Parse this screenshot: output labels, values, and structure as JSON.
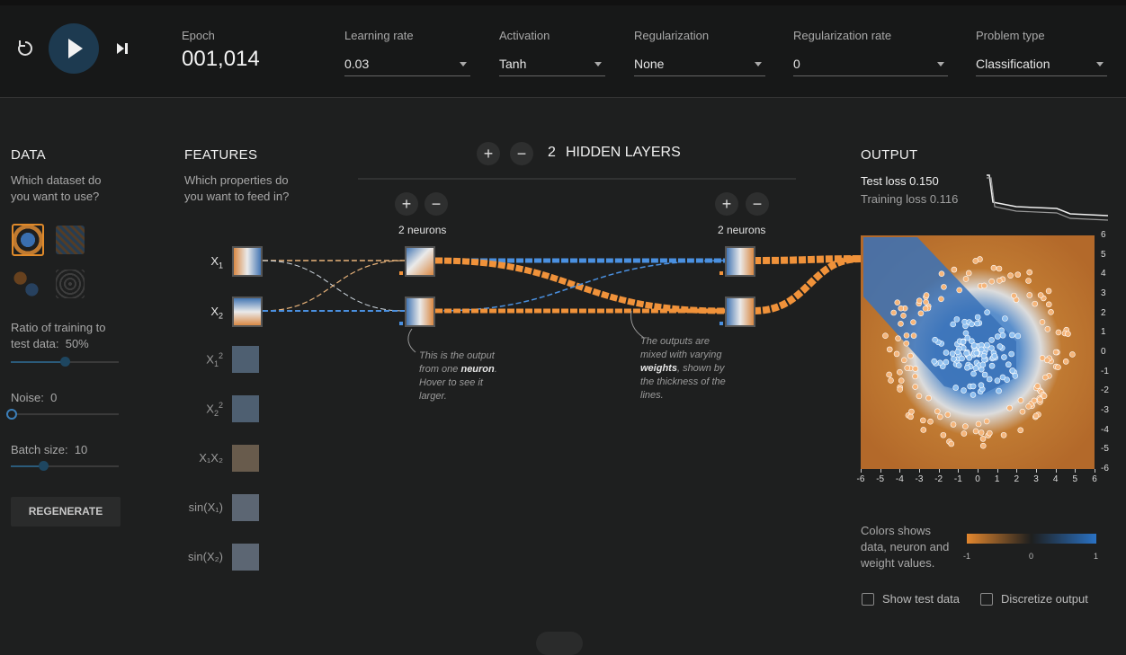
{
  "topbar": {
    "epoch_label": "Epoch",
    "epoch_value": "001,014",
    "learning_rate": {
      "label": "Learning rate",
      "value": "0.03"
    },
    "activation": {
      "label": "Activation",
      "value": "Tanh"
    },
    "regularization": {
      "label": "Regularization",
      "value": "None"
    },
    "regularization_rate": {
      "label": "Regularization rate",
      "value": "0"
    },
    "problem_type": {
      "label": "Problem type",
      "value": "Classification"
    }
  },
  "data_panel": {
    "title": "DATA",
    "subtitle": "Which dataset do you want to use?",
    "ratio_label": "Ratio of training to test data:",
    "ratio_value": "50%",
    "ratio_fraction": 0.5,
    "noise_label": "Noise:",
    "noise_value": "0",
    "noise_fraction": 0,
    "batch_label": "Batch size:",
    "batch_value": "10",
    "batch_fraction": 0.3,
    "regenerate": "REGENERATE"
  },
  "features_panel": {
    "title": "FEATURES",
    "subtitle": "Which properties do you want to feed in?",
    "features": [
      {
        "name": "X",
        "sub": "1",
        "sup": "",
        "active": true
      },
      {
        "name": "X",
        "sub": "2",
        "sup": "",
        "active": true
      },
      {
        "name": "X",
        "sub": "1",
        "sup": "2",
        "active": false
      },
      {
        "name": "X",
        "sub": "2",
        "sup": "2",
        "active": false
      },
      {
        "name": "X₁X₂",
        "sub": "",
        "sup": "",
        "active": false
      },
      {
        "name": "sin(X₁)",
        "sub": "",
        "sup": "",
        "active": false
      },
      {
        "name": "sin(X₂)",
        "sub": "",
        "sup": "",
        "active": false
      }
    ]
  },
  "network": {
    "hidden_layers_count": "2",
    "hidden_layers_label": "HIDDEN LAYERS",
    "layer1_neurons": "2 neurons",
    "layer2_neurons": "2 neurons",
    "note_neuron": "This is the output from one neuron. Hover to see it larger.",
    "note_neuron_bold": "neuron",
    "note_weights": "The outputs are mixed with varying weights, shown by the thickness of the lines.",
    "note_weights_bold": "weights"
  },
  "output_panel": {
    "title": "OUTPUT",
    "test_loss": "Test loss 0.150",
    "training_loss": "Training loss 0.116",
    "axis_ticks": [
      "-6",
      "-5",
      "-4",
      "-3",
      "-2",
      "-1",
      "0",
      "1",
      "2",
      "3",
      "4",
      "5",
      "6"
    ],
    "legend_text": "Colors shows data, neuron and weight values.",
    "legend_ticks": [
      "-1",
      "0",
      "1"
    ],
    "show_test_data": "Show test data",
    "discretize_output": "Discretize output"
  },
  "colors": {
    "orange": "#f59322",
    "blue": "#0877bd",
    "background": "#1e1f1f"
  }
}
